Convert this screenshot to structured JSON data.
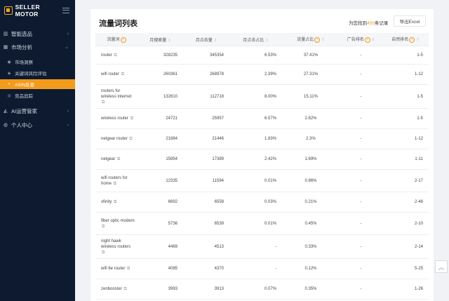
{
  "sidebar": {
    "brand": "SELLER MOTOR",
    "menu": [
      {
        "label": "智能选品",
        "icon": "chart-icon",
        "expanded": false
      },
      {
        "label": "市场分析",
        "icon": "grid-icon",
        "expanded": true
      }
    ],
    "submenu": [
      {
        "label": "市场洞察",
        "icon": "eye-icon",
        "active": false
      },
      {
        "label": "关键词风险评估",
        "icon": "shield-icon",
        "active": false
      },
      {
        "label": "ASIN反查",
        "icon": "search-icon",
        "active": true
      },
      {
        "label": "竞品追踪",
        "icon": "target-icon",
        "active": false
      }
    ],
    "menu2": [
      {
        "label": "AI运营管家",
        "icon": "robot-icon",
        "expanded": false
      },
      {
        "label": "个人中心",
        "icon": "user-icon",
        "expanded": false
      }
    ]
  },
  "card": {
    "title": "流量词列表",
    "found_prefix": "为您找到",
    "found_count": "455",
    "found_suffix": "条记录",
    "export_label": "导出Excel"
  },
  "table": {
    "headers": [
      "流量词",
      "月搜索量",
      "月点击量",
      "月点击占比",
      "流量占比",
      "广告排名",
      "自然排名"
    ],
    "rows": [
      {
        "kw": "router",
        "search": "328235",
        "clicks": "345354",
        "click_share": "6.53%",
        "traffic_share": "37.41%",
        "ad_rank": "-",
        "natural_rank": "1-5"
      },
      {
        "kw": "wifi router",
        "search": "260361",
        "clicks": "268978",
        "click_share": "2.39%",
        "traffic_share": "27.31%",
        "ad_rank": "-",
        "natural_rank": "1-12"
      },
      {
        "kw": "routers for wireless internet",
        "search": "132610",
        "clicks": "112718",
        "click_share": "8.00%",
        "traffic_share": "15.11%",
        "ad_rank": "-",
        "natural_rank": "1-5"
      },
      {
        "kw": "wireless router",
        "search": "24721",
        "clicks": "25957",
        "click_share": "6.57%",
        "traffic_share": "2.82%",
        "ad_rank": "-",
        "natural_rank": "1-5"
      },
      {
        "kw": "netgear router",
        "search": "21884",
        "clicks": "21446",
        "click_share": "1.83%",
        "traffic_share": "2.3%",
        "ad_rank": "-",
        "natural_rank": "1-12"
      },
      {
        "kw": "netgear",
        "search": "15954",
        "clicks": "17389",
        "click_share": "2.42%",
        "traffic_share": "1.69%",
        "ad_rank": "-",
        "natural_rank": "1-11"
      },
      {
        "kw": "wifi routers for home",
        "search": "12335",
        "clicks": "11594",
        "click_share": "0.01%",
        "traffic_share": "0.86%",
        "ad_rank": "-",
        "natural_rank": "2-17"
      },
      {
        "kw": "xfinity",
        "search": "6692",
        "clicks": "6558",
        "click_share": "0.03%",
        "traffic_share": "0.21%",
        "ad_rank": "-",
        "natural_rank": "2-46"
      },
      {
        "kw": "fiber optic modem",
        "search": "5736",
        "clicks": "6539",
        "click_share": "0.01%",
        "traffic_share": "0.45%",
        "ad_rank": "-",
        "natural_rank": "2-10"
      },
      {
        "kw": "night hawk wireless routers",
        "search": "4469",
        "clicks": "4513",
        "click_share": "-",
        "traffic_share": "0.33%",
        "ad_rank": "-",
        "natural_rank": "2-14"
      },
      {
        "kw": "wifi 6e router",
        "search": "4085",
        "clicks": "4370",
        "click_share": "-",
        "traffic_share": "0.12%",
        "ad_rank": "-",
        "natural_rank": "5-25"
      },
      {
        "kw": "zenbooster",
        "search": "3993",
        "clicks": "3913",
        "click_share": "0.07%",
        "traffic_share": "0.35%",
        "ad_rank": "-",
        "natural_rank": "1-26"
      }
    ],
    "row_heights": [
      26,
      29,
      34,
      29,
      29,
      29,
      32,
      29,
      32,
      34,
      29,
      29
    ]
  },
  "colors": {
    "sidebar_bg": "#0d1a30",
    "accent": "#f39b1c"
  }
}
